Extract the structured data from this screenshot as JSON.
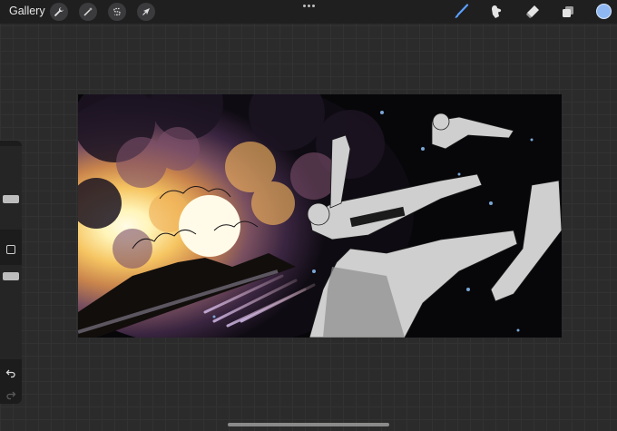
{
  "topbar": {
    "gallery_label": "Gallery",
    "left_tools": [
      {
        "name": "actions",
        "icon": "wrench-icon"
      },
      {
        "name": "adjustments",
        "icon": "magic-wand-icon"
      },
      {
        "name": "selection",
        "icon": "selection-s-icon"
      },
      {
        "name": "transform",
        "icon": "arrow-cursor-icon"
      }
    ],
    "right_tools": [
      {
        "name": "brush",
        "icon": "brush-icon",
        "active": true
      },
      {
        "name": "smudge",
        "icon": "smudge-finger-icon"
      },
      {
        "name": "eraser",
        "icon": "eraser-icon"
      },
      {
        "name": "layers",
        "icon": "layers-icon"
      }
    ],
    "current_color": "#8fb8f2",
    "accent_color": "#5aa0ff"
  },
  "sidebar": {
    "brush_size_slider": "size-slider",
    "opacity_slider": "opacity-slider",
    "modify_button": "square-icon",
    "undo_icon": "undo-icon",
    "redo_icon": "redo-icon"
  },
  "canvas": {
    "description_icon": "artwork-canvas"
  }
}
